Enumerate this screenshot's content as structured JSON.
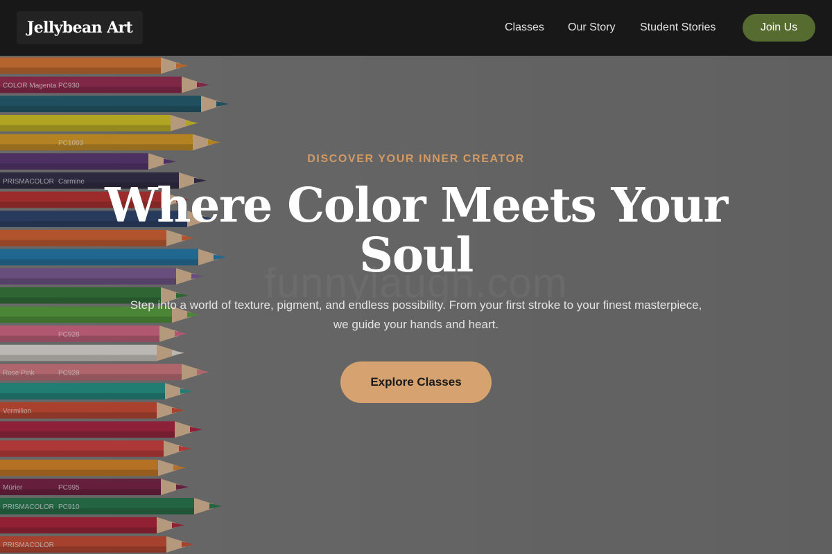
{
  "header": {
    "logo": "Jellybean Art",
    "nav": [
      {
        "label": "Classes"
      },
      {
        "label": "Our Story"
      },
      {
        "label": "Student Stories"
      }
    ],
    "cta_label": "Join Us"
  },
  "hero": {
    "eyebrow": "DISCOVER YOUR INNER CREATOR",
    "title": "Where Color Meets Your Soul",
    "description": "Step into a world of texture, pigment, and endless possibility. From your first stroke to your finest masterpiece, we guide your hands and heart.",
    "cta_label": "Explore Classes",
    "watermark": "funnylaugh.com"
  },
  "colors": {
    "header_bg": "#181818",
    "join_button": "#566b30",
    "accent": "#d49a62",
    "cta_button": "#d5a270"
  },
  "pencils": [
    {
      "color": "#e8792b",
      "label": "",
      "code": ""
    },
    {
      "color": "#a0244f",
      "label": "COLOR Magenta",
      "code": "PC930"
    },
    {
      "color": "#1b5c73",
      "label": "",
      "code": ""
    },
    {
      "color": "#e3d21f",
      "label": "",
      "code": ""
    },
    {
      "color": "#e8a31f",
      "label": "",
      "code": "PC1003"
    },
    {
      "color": "#5a3378",
      "label": "",
      "code": ""
    },
    {
      "color": "#2b2745",
      "label": "PRISMACOLOR",
      "code": "Carmine"
    },
    {
      "color": "#c62b2b",
      "label": "",
      "code": ""
    },
    {
      "color": "#27406e",
      "label": "",
      "code": ""
    },
    {
      "color": "#e4622c",
      "label": "",
      "code": ""
    },
    {
      "color": "#1d7fb6",
      "label": "",
      "code": ""
    },
    {
      "color": "#7d5a9a",
      "label": "",
      "code": ""
    },
    {
      "color": "#2e7a35",
      "label": "",
      "code": ""
    },
    {
      "color": "#55a83a",
      "label": "",
      "code": ""
    },
    {
      "color": "#e4688a",
      "label": "",
      "code": "PC928"
    },
    {
      "color": "#f2ede6",
      "label": "",
      "code": ""
    },
    {
      "color": "#e07a84",
      "label": "Rose Pink",
      "code": "PC928"
    },
    {
      "color": "#1c9b8d",
      "label": "",
      "code": ""
    },
    {
      "color": "#d8492e",
      "label": "Vermilion",
      "code": ""
    },
    {
      "color": "#b01d3d",
      "label": "",
      "code": ""
    },
    {
      "color": "#e03b3b",
      "label": "",
      "code": ""
    },
    {
      "color": "#e8891f",
      "label": "",
      "code": ""
    },
    {
      "color": "#7a1840",
      "label": "Mürier",
      "code": "PC995"
    },
    {
      "color": "#1f7a4a",
      "label": "PRISMACOLOR",
      "code": "PC910"
    },
    {
      "color": "#b81c34",
      "label": "",
      "code": ""
    },
    {
      "color": "#d4482d",
      "label": "PRISMACOLOR",
      "code": ""
    }
  ]
}
